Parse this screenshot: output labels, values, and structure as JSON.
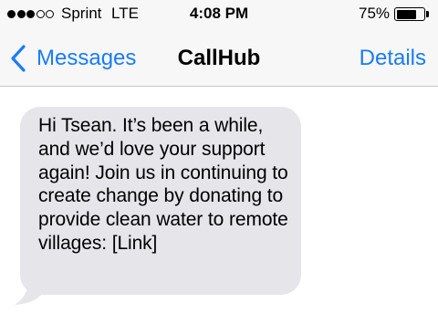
{
  "status_bar": {
    "signal_dots": [
      true,
      true,
      true,
      false,
      false
    ],
    "carrier": "Sprint",
    "network": "LTE",
    "time": "4:08 PM",
    "battery_percent": "75%",
    "battery_level": 0.75
  },
  "nav": {
    "back_label": "Messages",
    "title": "CallHub",
    "details_label": "Details",
    "back_icon": "chevron-left-icon"
  },
  "thread": {
    "messages": [
      {
        "direction": "incoming",
        "text": "Hi Tsean. It’s been a while, and we’d love your support again! Join us in continuing to create change by donating to provide clean water to remote villages: [Link]"
      }
    ]
  },
  "colors": {
    "accent": "#1a7cf5",
    "bar_background": "#f7f7f8",
    "incoming_bubble": "#e5e5ea"
  }
}
